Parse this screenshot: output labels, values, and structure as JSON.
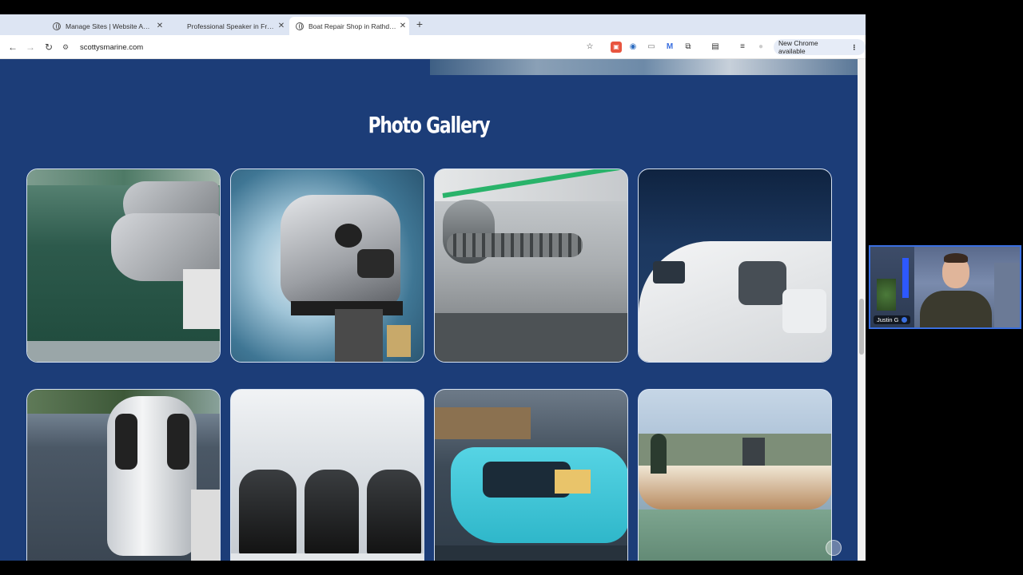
{
  "browser": {
    "tabs": [
      {
        "title": "Manage Sites | Website Admin",
        "active": false
      },
      {
        "title": "Professional Speaker in Frank",
        "active": false
      },
      {
        "title": "Boat Repair Shop in Rathdrum",
        "active": true
      }
    ],
    "new_tab_symbol": "+",
    "url": "scottysmarine.com",
    "chrome_update_label": "New Chrome available"
  },
  "page": {
    "gallery_title": "Photo Gallery",
    "photos": [
      {
        "subject": "twin outboard motors on dock"
      },
      {
        "subject": "silver outboard motor in wake"
      },
      {
        "subject": "anchor windlass and chain"
      },
      {
        "subject": "white speedboat bow on water"
      },
      {
        "subject": "white outboard motor on lake"
      },
      {
        "subject": "three black outboard motors"
      },
      {
        "subject": "turquoise cabin boat at dock"
      },
      {
        "subject": "speedboat with passengers"
      }
    ]
  },
  "webcam": {
    "participant_name": "Justin G"
  },
  "colors": {
    "page_background": "#1c3d78",
    "tab_strip": "#dde5f3",
    "accent_blue": "#3a6fe0"
  }
}
